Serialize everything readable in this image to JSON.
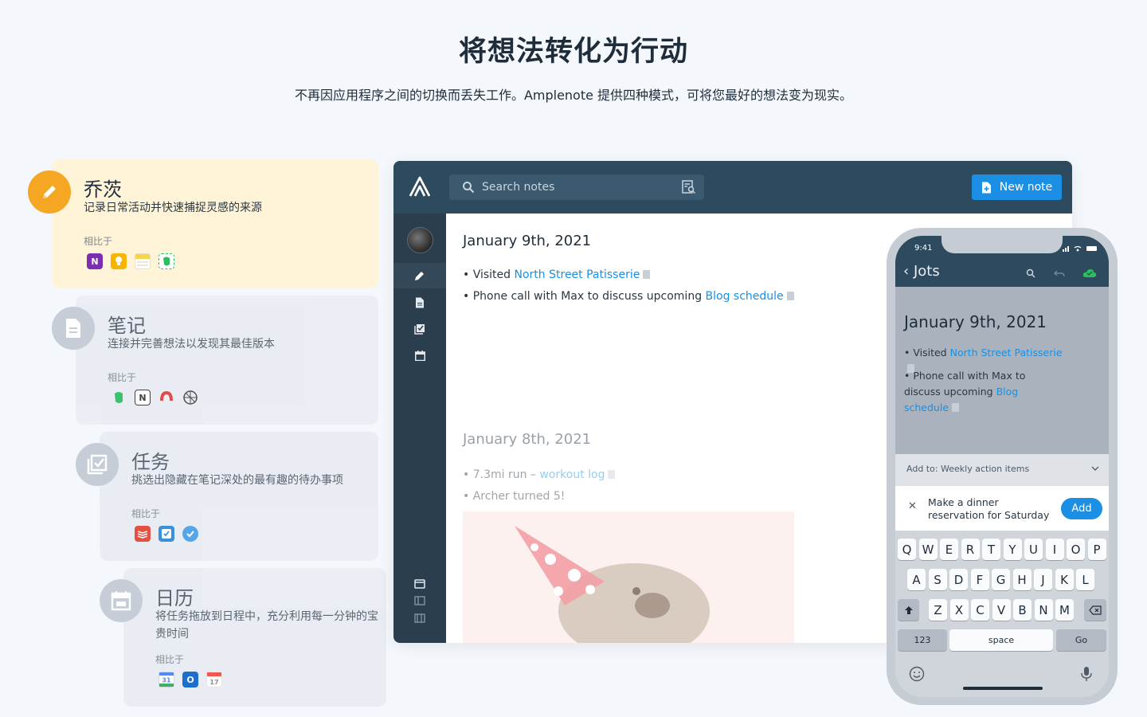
{
  "hero": {
    "title": "将想法转化为行动",
    "subtitle": "不再因应用程序之间的切换而丢失工作。Amplenote 提供四种模式，可将您最好的想法变为现实。"
  },
  "modes": [
    {
      "title": "乔茨",
      "desc": "记录日常活动并快速捕捉灵感的来源",
      "compare": "相比于",
      "icon": "pencil-icon",
      "apps": [
        "onenote-icon",
        "keep-icon",
        "apple-notes-icon",
        "evernote-icon"
      ]
    },
    {
      "title": "笔记",
      "desc": "连接并完善想法以发现其最佳版本",
      "compare": "相比于",
      "icon": "document-icon",
      "apps": [
        "evernote-icon",
        "notion-icon",
        "roam-icon",
        "obsidian-icon"
      ]
    },
    {
      "title": "任务",
      "desc": "挑选出隐藏在笔记深处的最有趣的待办事项",
      "compare": "相比于",
      "icon": "checkbox-icon",
      "apps": [
        "todoist-icon",
        "microsoft-todo-icon",
        "things-icon"
      ]
    },
    {
      "title": "日历",
      "desc": "将任务拖放到日程中，充分利用每一分钟的宝贵时间",
      "compare": "相比于",
      "icon": "calendar-icon",
      "apps": [
        "google-calendar-icon",
        "outlook-icon",
        "apple-calendar-icon"
      ]
    }
  ],
  "desktop": {
    "search_placeholder": "Search notes",
    "new_note_label": "New note",
    "entries": [
      {
        "date": "January 9th, 2021",
        "bullets": [
          {
            "prefix": "Visited ",
            "link": "North Street Patisserie"
          },
          {
            "prefix": "Phone call with Max to discuss upcoming ",
            "link": "Blog schedule"
          }
        ]
      },
      {
        "date": "January 8th, 2021",
        "bullets": [
          {
            "prefix": "7.3mi run – ",
            "link": "workout log"
          },
          {
            "prefix": "Archer turned 5!",
            "link": ""
          }
        ]
      }
    ]
  },
  "phone": {
    "time": "9:41",
    "title": "Jots",
    "date": "January 9th, 2021",
    "b1_prefix": "Visited ",
    "b1_link": "North Street Patisserie",
    "b2_prefix": "Phone call with Max to discuss upcoming ",
    "b2_link": "Blog schedule",
    "add_to": "Add to: Weekly action items",
    "task_text": "Make a dinner reservation for Saturday",
    "add_label": "Add",
    "keyboard": {
      "row1": [
        "Q",
        "W",
        "E",
        "R",
        "T",
        "Y",
        "U",
        "I",
        "O",
        "P"
      ],
      "row2": [
        "A",
        "S",
        "D",
        "F",
        "G",
        "H",
        "J",
        "K",
        "L"
      ],
      "row3": [
        "Z",
        "X",
        "C",
        "V",
        "B",
        "N",
        "M"
      ],
      "num": "123",
      "space": "space",
      "go": "Go"
    }
  },
  "colors": {
    "accent": "#1a8fe3",
    "topbar": "#2d4a5e",
    "jots_card": "#fff4d8",
    "jots_icon": "#f5a623"
  }
}
